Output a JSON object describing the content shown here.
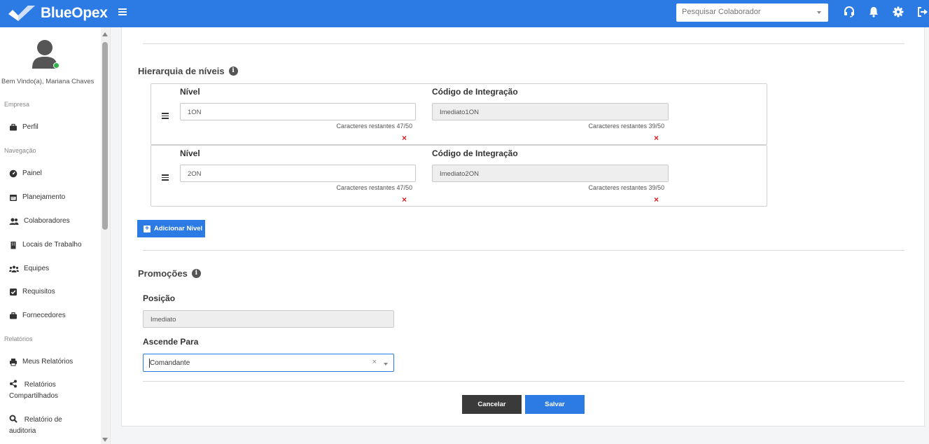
{
  "app": {
    "brand": "BlueOpex"
  },
  "header": {
    "search_placeholder": "Pesquisar Colaborador",
    "icons": [
      "headset-icon",
      "bell-icon",
      "gear-icon",
      "logout-icon"
    ]
  },
  "sidebar": {
    "welcome": "Bem Vindo(a), Mariana Chaves",
    "sections": {
      "empresa": "Empresa",
      "navegacao": "Navegação",
      "relatorios": "Relatórios"
    },
    "items": {
      "perfil": "Perfil",
      "painel": "Painel",
      "planejamento": "Planejamento",
      "colaboradores": "Colaboradores",
      "locais": "Locais de Trabalho",
      "equipes": "Equipes",
      "requisitos": "Requisitos",
      "fornecedores": "Fornecedores",
      "meus_relatorios": "Meus Relatórios",
      "relatorios_comp_1": "Relatórios",
      "relatorios_comp_2": "Compartilhados",
      "auditoria_1": "Relatório de",
      "auditoria_2": "auditoria"
    }
  },
  "hierarchy": {
    "title": "Hierarquia de níveis",
    "info_glyph": "i",
    "levels": [
      {
        "level_label": "Nível",
        "level_value": "1ON",
        "level_counter": "Caracteres restantes 47/50",
        "code_label": "Código de Integração",
        "code_value": "Imediato1ON",
        "code_counter": "Caracteres restantes 39/50"
      },
      {
        "level_label": "Nível",
        "level_value": "2ON",
        "level_counter": "Caracteres restantes 47/50",
        "code_label": "Código de Integração",
        "code_value": "Imediato2ON",
        "code_counter": "Caracteres restantes 39/50"
      }
    ],
    "remove_glyph": "×",
    "add_button": "Adicionar Nível",
    "add_glyph": "+"
  },
  "promotions": {
    "title": "Promoções",
    "info_glyph": "i",
    "position_label": "Posição",
    "position_value": "Imediato",
    "ascends_label": "Ascende Para",
    "ascends_value": "Comandante",
    "clear_glyph": "×"
  },
  "actions": {
    "cancel": "Cancelar",
    "save": "Salvar"
  },
  "colors": {
    "primary": "#2c7be5",
    "dark_button": "#3a3a3a",
    "remove": "#e31b1b",
    "online": "#2db34a"
  }
}
